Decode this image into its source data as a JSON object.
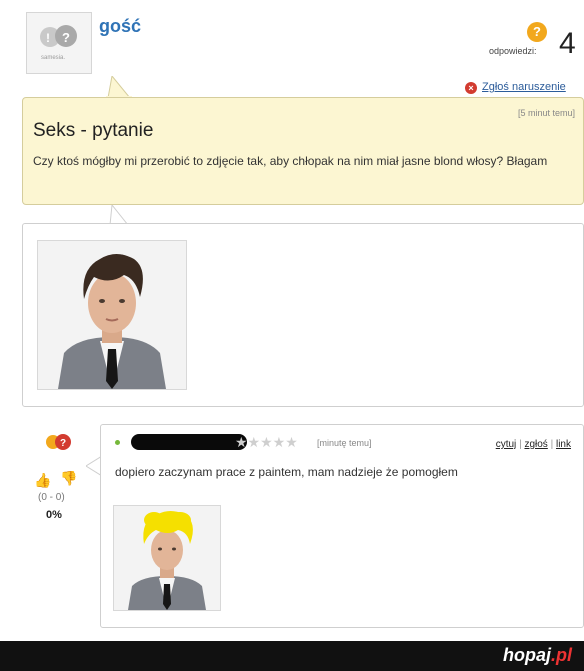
{
  "question": {
    "avatar_label": "samesia.",
    "username": "gość",
    "answers_label": "odpowiedzi:",
    "answers_count": "4",
    "report_label": "Zgłoś naruszenie",
    "time": "[5 minut temu]",
    "title": "Seks - pytanie",
    "body": "Czy ktoś mógłby mi przerobić to zdjęcie tak, aby chłopak na nim miał jasne blond włosy? Błagam"
  },
  "answer": {
    "stars": "★★★★★",
    "time": "[minutę temu]",
    "actions": {
      "quote": "cytuj",
      "report": "zgłoś",
      "link": "link"
    },
    "text": "dopiero zaczynam prace z paintem, mam nadzieje że pomogłem",
    "votes": "(0 - 0)",
    "percent": "0%"
  },
  "footer": {
    "site": "hopaj",
    "tld": ".pl"
  },
  "colors": {
    "username": "#2f73b6",
    "bubble": "#fcf6d2",
    "accent_orange": "#f2a81d",
    "report_red": "#d23b30",
    "blond": "#f5e000"
  }
}
